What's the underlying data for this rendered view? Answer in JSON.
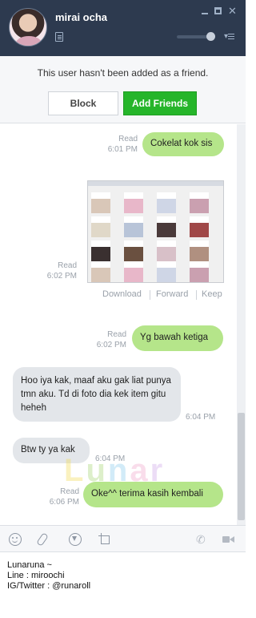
{
  "header": {
    "contact_name": "mirai ocha",
    "volume_level": 0.92
  },
  "banner": {
    "notice": "This user hasn't been added as a friend.",
    "block_label": "Block",
    "add_label": "Add Friends"
  },
  "messages": [
    {
      "side": "mine",
      "text": "Cokelat kok sis",
      "status": "Read",
      "time": "6:01 PM"
    },
    {
      "side": "mine",
      "type": "photo",
      "status": "Read",
      "time": "6:02 PM",
      "actions": [
        "Download",
        "Forward",
        "Keep"
      ]
    },
    {
      "side": "mine",
      "text": "Yg bawah ketiga",
      "status": "Read",
      "time": "6:02 PM"
    },
    {
      "side": "theirs",
      "text": "Hoo iya kak, maaf aku gak liat punya tmn aku. Td di foto dia kek item gitu heheh",
      "time": "6:04 PM"
    },
    {
      "side": "theirs",
      "text": "Btw ty ya kak",
      "time": "6:04 PM"
    },
    {
      "side": "mine",
      "text": "Oke^^ terima kasih kembali",
      "status": "Read",
      "time": "6:06 PM"
    }
  ],
  "watermark": {
    "letters": [
      "L",
      "u",
      "n",
      "a",
      "r"
    ],
    "colors": [
      "#f2d94a",
      "#9fd36a",
      "#7fc8ec",
      "#f0a0c8",
      "#c9a0e8"
    ]
  },
  "toolbar": {
    "icons": [
      "emoji-icon",
      "attach-icon",
      "keep-icon",
      "crop-icon",
      "call-icon",
      "video-icon"
    ]
  },
  "input": {
    "lines": [
      "Lunaruna ~",
      "Line : miroochi",
      "IG/Twitter : @runaroll"
    ]
  },
  "colors": {
    "header_bg": "#2d3a4f",
    "add_button": "#26b52a",
    "my_bubble": "#b5e58a",
    "their_bubble": "#e3e6ea"
  }
}
